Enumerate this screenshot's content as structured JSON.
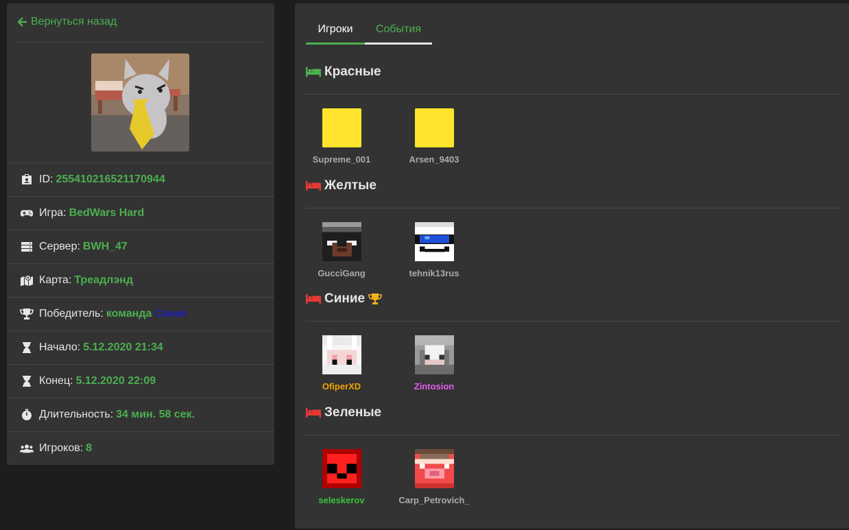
{
  "back": {
    "label": "Вернуться назад"
  },
  "info": {
    "id": {
      "label": "ID:",
      "value": "255410216521170944"
    },
    "game": {
      "label": "Игра:",
      "value": "BedWars Hard"
    },
    "server": {
      "label": "Сервер:",
      "value": "BWH_47"
    },
    "map": {
      "label": "Карта:",
      "value": "Треадлэнд"
    },
    "winner": {
      "label": "Победитель:",
      "value": "команда",
      "team": "Синие"
    },
    "start": {
      "label": "Начало:",
      "value": "5.12.2020 21:34"
    },
    "end": {
      "label": "Конец:",
      "value": "5.12.2020 22:09"
    },
    "duration": {
      "label": "Длительность:",
      "value": "34 мин. 58 сек."
    },
    "players": {
      "label": "Игроков:",
      "value": "8"
    }
  },
  "tabs": [
    {
      "label": "Игроки",
      "active": true
    },
    {
      "label": "События",
      "active": false
    }
  ],
  "teams": [
    {
      "name": "Красные",
      "bed_color": "#4caf50",
      "players": [
        "Supreme_001",
        "Arsen_9403"
      ]
    },
    {
      "name": "Желтые",
      "bed_color": "#e53935",
      "players": [
        "GucciGang",
        "tehnik13rus"
      ]
    },
    {
      "name": "Синие",
      "bed_color": "#e53935",
      "winner": true,
      "players": [
        "OfiperXD",
        "Zintosion"
      ]
    },
    {
      "name": "Зеленые",
      "bed_color": "#e53935",
      "players": [
        "seleskerov",
        "Carp_Petrovich_"
      ]
    }
  ],
  "colors": {
    "accent": "#4caf50",
    "winner_team": "#1414e8",
    "gold_name": "#f2a300",
    "pink_name": "#e85cf0",
    "green_name": "#3ac23a"
  }
}
